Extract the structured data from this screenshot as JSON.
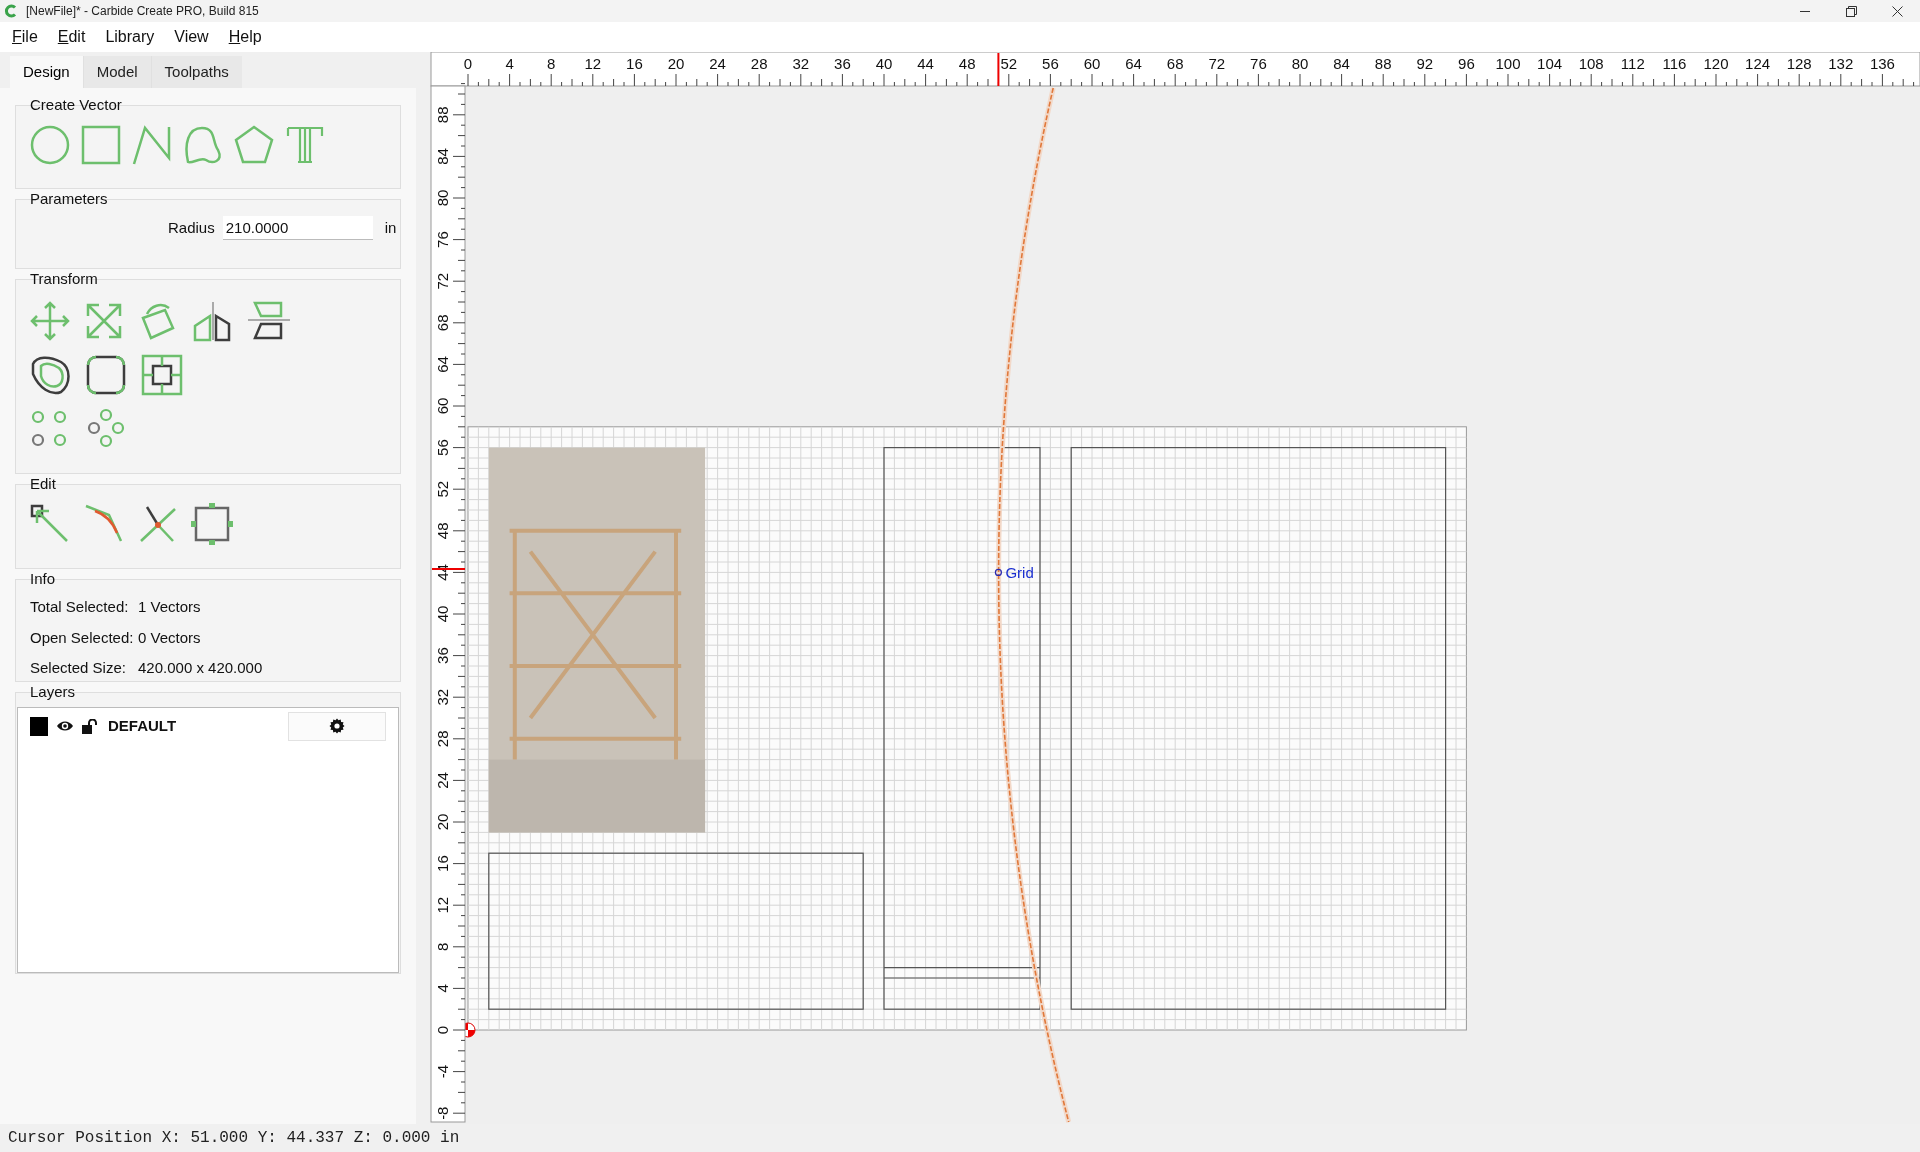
{
  "window": {
    "title": "[NewFile]* - Carbide Create PRO, Build 815"
  },
  "menu": [
    {
      "label": "File",
      "underlined": true
    },
    {
      "label": "Edit",
      "underlined": true
    },
    {
      "label": "Library",
      "underlined": false
    },
    {
      "label": "View",
      "underlined": false
    },
    {
      "label": "Help",
      "underlined": true
    }
  ],
  "tabs": [
    {
      "label": "Design",
      "selected": true
    },
    {
      "label": "Model",
      "selected": false
    },
    {
      "label": "Toolpaths",
      "selected": false
    }
  ],
  "create_vector": {
    "title": "Create Vector"
  },
  "parameters": {
    "title": "Parameters",
    "label": "Radius",
    "value": "210.0000",
    "unit": "in"
  },
  "transform": {
    "title": "Transform"
  },
  "edit": {
    "title": "Edit"
  },
  "info": {
    "title": "Info",
    "rows": [
      {
        "label": "Total Selected:",
        "value": "1 Vectors"
      },
      {
        "label": "Open Selected:",
        "value": "0 Vectors"
      },
      {
        "label": "Selected Size:",
        "value": "420.000 x 420.000"
      }
    ]
  },
  "layers": {
    "title": "Layers",
    "items": [
      {
        "name": "DEFAULT",
        "visible": true,
        "locked": false
      }
    ]
  },
  "rulers": {
    "x_labels": [
      "0",
      "4",
      "8",
      "12",
      "16",
      "20",
      "24",
      "28",
      "32",
      "36",
      "40",
      "44",
      "48",
      "52",
      "56",
      "60",
      "64",
      "68",
      "72",
      "76",
      "80",
      "84",
      "88",
      "92",
      "96",
      "100",
      "104",
      "108",
      "112",
      "116",
      "120",
      "124",
      "128",
      "132",
      "136"
    ],
    "y_labels": [
      "-8",
      "-4",
      "0",
      "4",
      "8",
      "12",
      "16",
      "20",
      "24",
      "28",
      "32",
      "36",
      "40",
      "44",
      "48",
      "52",
      "56",
      "60",
      "64",
      "68",
      "72",
      "76",
      "80",
      "84",
      "88"
    ]
  },
  "canvas": {
    "snap_label": "Grid"
  },
  "status_bar": "Cursor Position X: 51.000 Y: 44.337 Z: 0.000 in"
}
